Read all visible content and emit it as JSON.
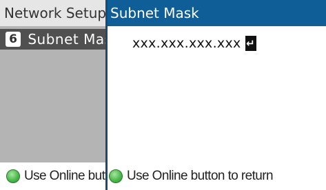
{
  "background_screen": {
    "header_title": "Network Setup",
    "selected_item": {
      "number": "6",
      "label": "Subnet Mask"
    },
    "footer_hint": "Use Online button to return"
  },
  "dialog": {
    "title": "Subnet Mask",
    "value": "xxx.xxx.xxx.xxx",
    "enter_icon_glyph": "↵",
    "footer_hint": "Use Online button to return"
  },
  "icons": {
    "online_button": "green-circle-online-icon",
    "enter_key": "enter-return-icon"
  },
  "colors": {
    "dialog_title_bg": "#0f5e97",
    "selected_item_bg": "#505050",
    "background_panel": "#b4b4b4",
    "online_icon": "#4cba4c"
  }
}
